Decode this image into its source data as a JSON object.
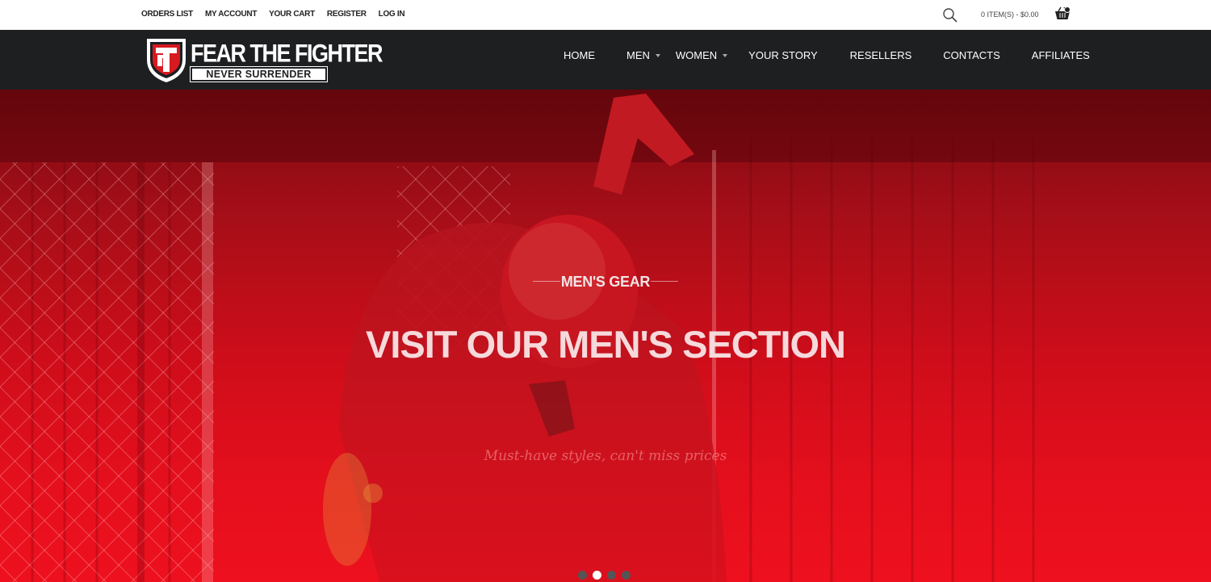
{
  "top_links": [
    "ORDERS LIST",
    "MY ACCOUNT",
    "YOUR CART",
    "REGISTER",
    "LOG IN"
  ],
  "cart": {
    "summary": "0 ITEM(S) - $0.00",
    "count": "0"
  },
  "logo": {
    "line1": "FEAR THE FIGHTER",
    "line2": "NEVER SURRENDER",
    "icon": "ftf-shield-logo"
  },
  "nav": [
    {
      "label": "HOME",
      "dropdown": false
    },
    {
      "label": "MEN",
      "dropdown": true
    },
    {
      "label": "WOMEN",
      "dropdown": true
    },
    {
      "label": "YOUR STORY",
      "dropdown": false
    },
    {
      "label": "RESELLERS",
      "dropdown": false
    },
    {
      "label": "CONTACTS",
      "dropdown": false
    },
    {
      "label": "AFFILIATES",
      "dropdown": false
    }
  ],
  "hero": {
    "subtitle": "MEN'S GEAR",
    "title": "VISIT OUR MEN'S SECTION",
    "tagline": "Must-have styles, can't miss prices",
    "slides": 4,
    "active_slide": 2
  },
  "colors": {
    "header_bg": "#1e1f21",
    "hero_red": "#e50f1d",
    "logo_red": "#d71920"
  },
  "icons": {
    "search": "search-icon",
    "cart": "basket-icon"
  }
}
